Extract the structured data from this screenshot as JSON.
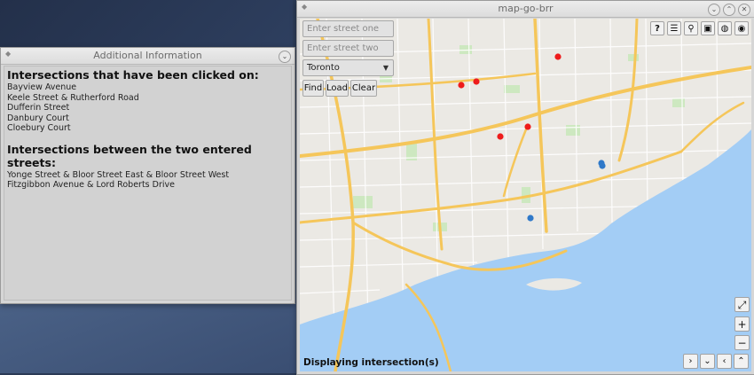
{
  "info_window": {
    "title": "Additional Information",
    "clicked_heading": "Intersections that have been clicked on:",
    "clicked_items": [
      "Bayview Avenue",
      "Keele Street & Rutherford Road",
      "Dufferin Street",
      "Danbury Court",
      "Cloebury Court"
    ],
    "between_heading": "Intersections between the two entered streets:",
    "between_items": [
      "Yonge Street & Bloor Street East & Bloor Street West",
      "Fitzgibbon Avenue & Lord Roberts Drive"
    ]
  },
  "map_window": {
    "title": "map-go-brr",
    "street_one_placeholder": "Enter street one",
    "street_two_placeholder": "Enter street two",
    "city_selected": "Toronto",
    "buttons": {
      "find": "Find",
      "load": "Load",
      "clear": "Clear"
    },
    "toolbar_icons": [
      "help-icon",
      "list-icon",
      "location-pin-icon",
      "transit-icon",
      "map-layers-icon",
      "eye-icon"
    ],
    "toolbar_glyphs": [
      "?",
      "☰",
      "⚲",
      "▣",
      "◍",
      "◉"
    ],
    "zoom_controls": {
      "fit": "⤢",
      "zoom_in": "+",
      "zoom_out": "−"
    },
    "pan_controls": {
      "right": "›",
      "down": "⌄",
      "left": "‹",
      "up": "⌃"
    },
    "status_text": "Displaying intersection(s)",
    "marker_colors": {
      "clicked": "#ee1c1c",
      "between": "#2f79c9"
    },
    "water_color": "#a3cdf5",
    "road_color": "#f5c65a"
  }
}
